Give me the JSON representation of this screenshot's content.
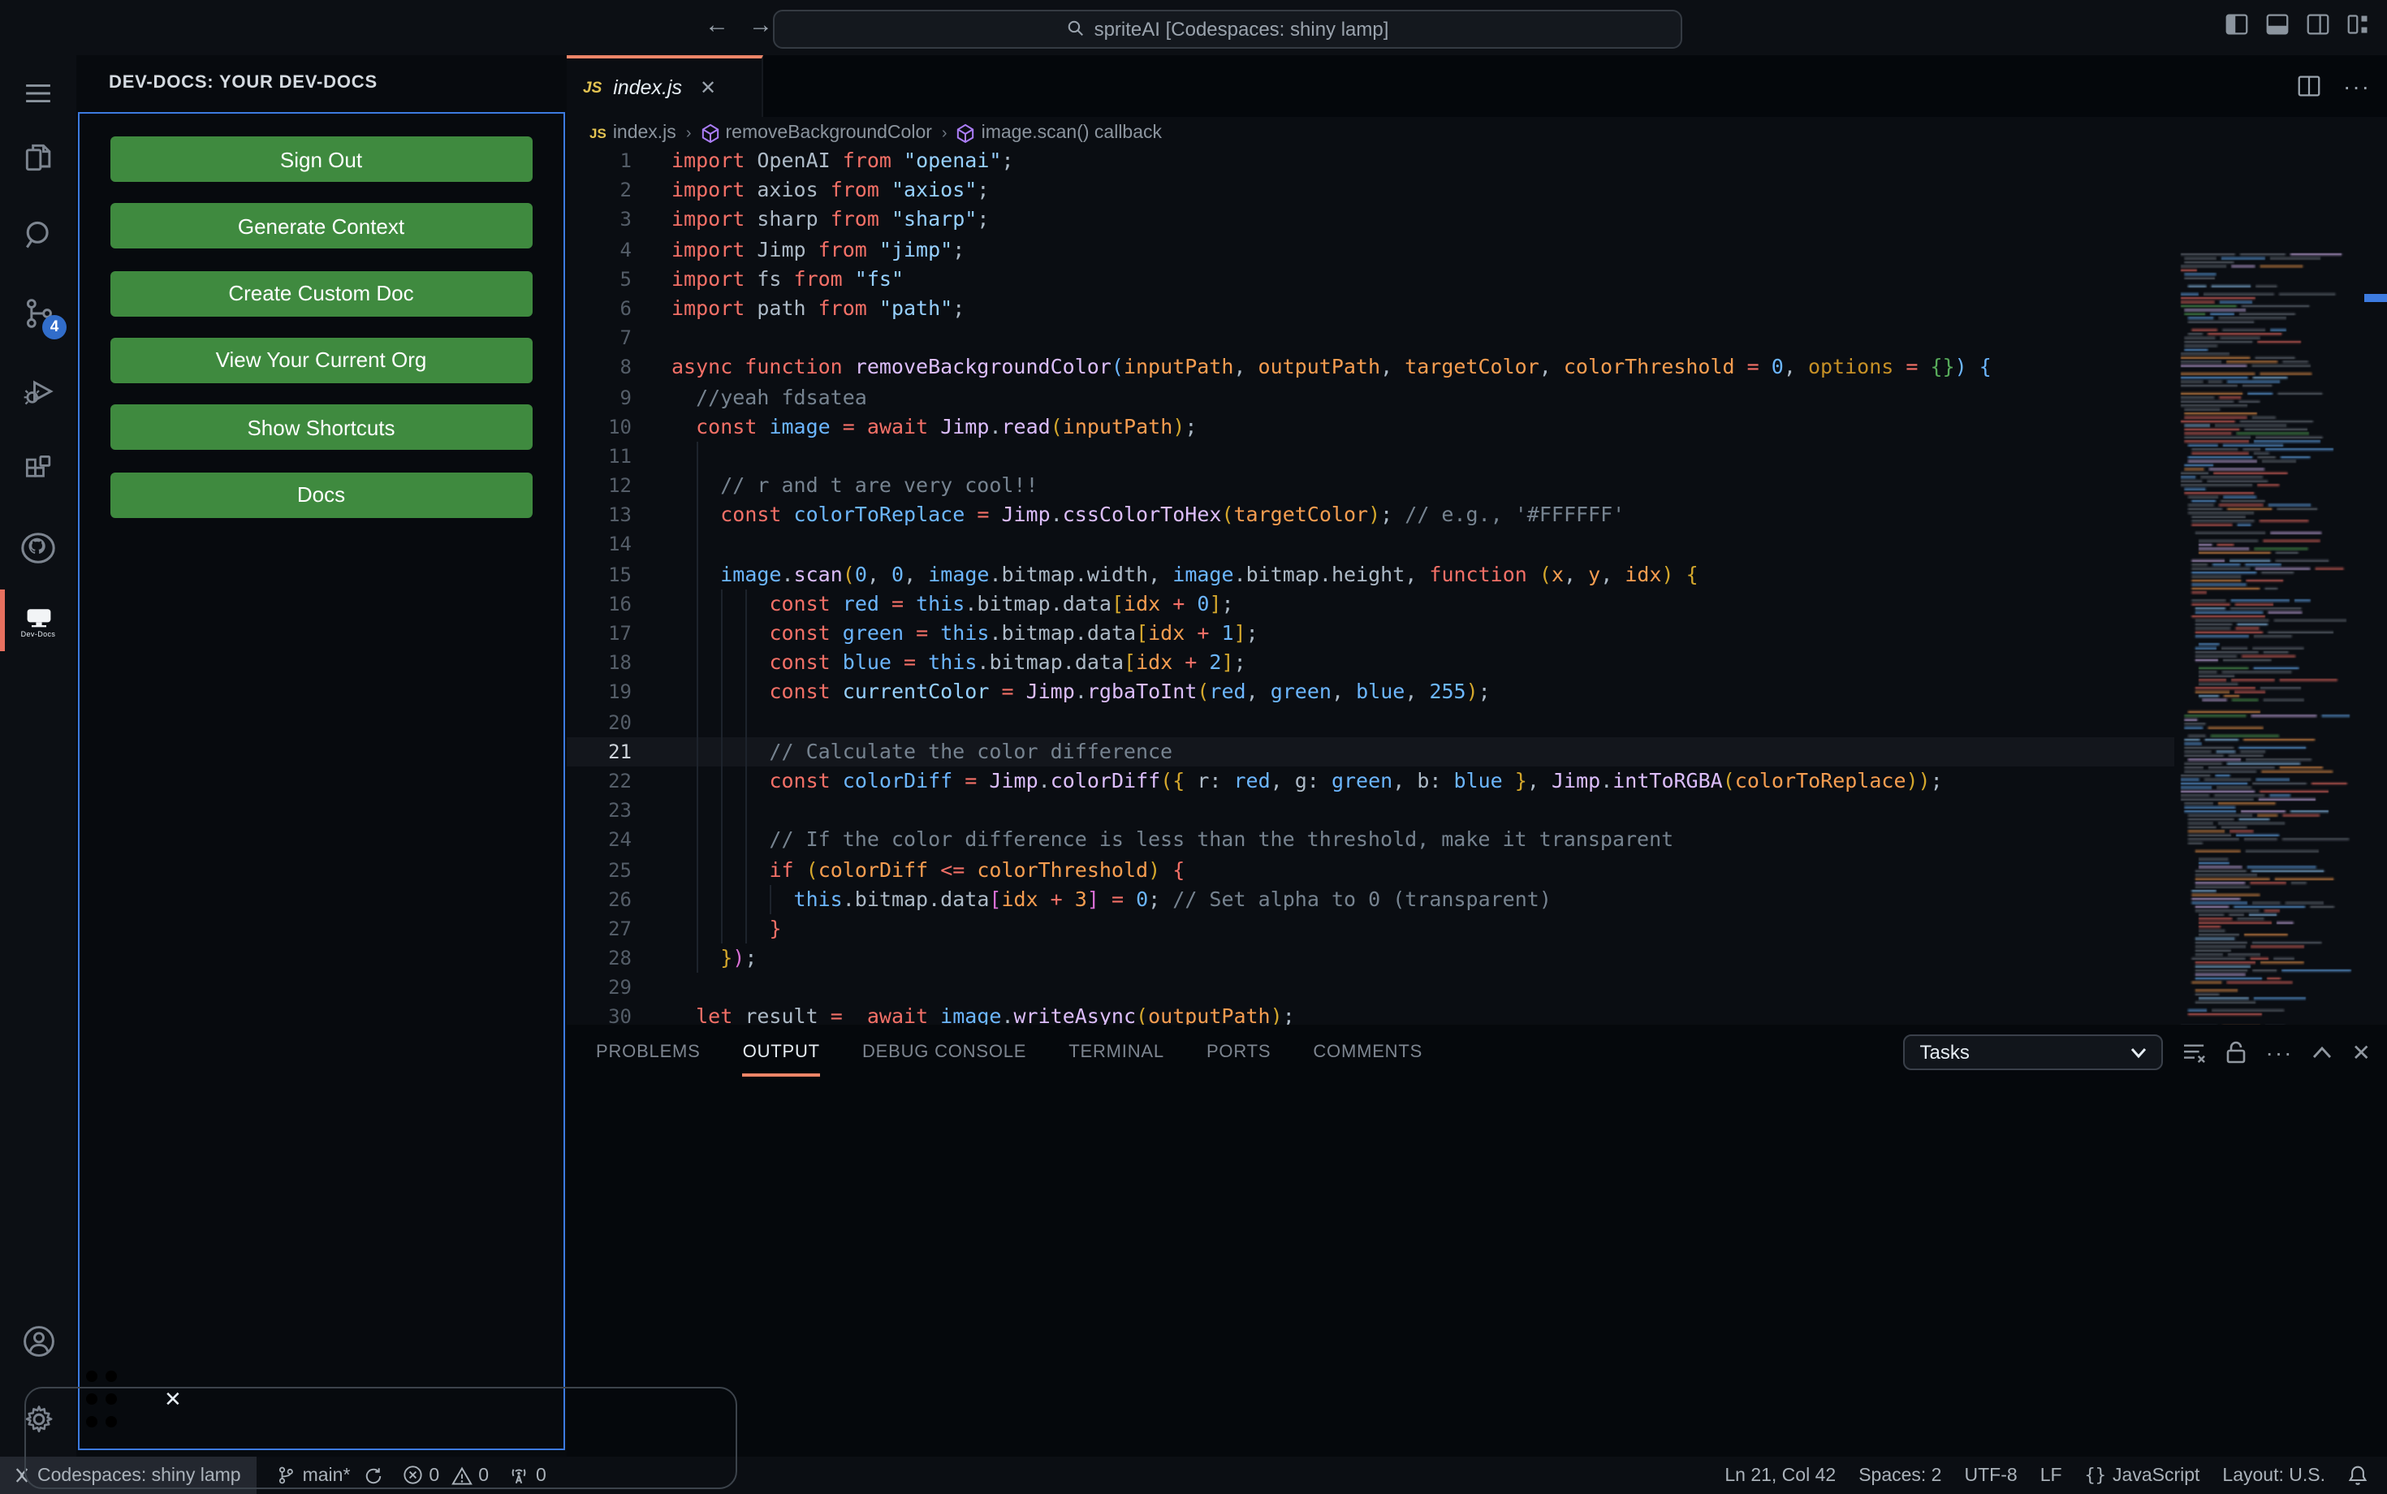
{
  "titlebar": {
    "search_value": "spriteAI [Codespaces: shiny lamp]",
    "back": "←",
    "forward": "→"
  },
  "activitybar": {
    "scm_badge": "4",
    "devdocs_label": "Dev-Docs"
  },
  "sidebar": {
    "header": "DEV-DOCS: YOUR DEV-DOCS",
    "buttons": [
      "Sign Out",
      "Generate Context",
      "Create Custom Doc",
      "View Your Current Org",
      "Show Shortcuts",
      "Docs"
    ],
    "webview_close": "✕"
  },
  "editor": {
    "tab": {
      "badge": "JS",
      "label": "index.js",
      "close": "✕"
    },
    "breadcrumbs": [
      {
        "icon": "js",
        "label": "index.js"
      },
      {
        "icon": "symbol",
        "label": "removeBackgroundColor"
      },
      {
        "icon": "symbol",
        "label": "image.scan() callback"
      }
    ],
    "active_line": 21,
    "code": {
      "lines": [
        [
          [
            "kw",
            "import"
          ],
          [
            "pl",
            " OpenAI "
          ],
          [
            "kw",
            "from"
          ],
          [
            "st",
            " \"openai\""
          ],
          [
            "pl",
            ";"
          ]
        ],
        [
          [
            "kw",
            "import"
          ],
          [
            "pl",
            " axios "
          ],
          [
            "kw",
            "from"
          ],
          [
            "st",
            " \"axios\""
          ],
          [
            "pl",
            ";"
          ]
        ],
        [
          [
            "kw",
            "import"
          ],
          [
            "pl",
            " sharp "
          ],
          [
            "kw",
            "from"
          ],
          [
            "st",
            " \"sharp\""
          ],
          [
            "pl",
            ";"
          ]
        ],
        [
          [
            "kw",
            "import"
          ],
          [
            "pl",
            " Jimp "
          ],
          [
            "kw",
            "from"
          ],
          [
            "st",
            " \"jimp\""
          ],
          [
            "pl",
            ";"
          ]
        ],
        [
          [
            "kw",
            "import"
          ],
          [
            "pl",
            " fs "
          ],
          [
            "kw",
            "from"
          ],
          [
            "st",
            " \"fs\""
          ]
        ],
        [
          [
            "kw",
            "import"
          ],
          [
            "pl",
            " path "
          ],
          [
            "kw",
            "from"
          ],
          [
            "st",
            " \"path\""
          ],
          [
            "pl",
            ";"
          ]
        ],
        [],
        [
          [
            "kw",
            "async function"
          ],
          [
            "fn",
            " removeBackgroundColor"
          ],
          [
            "b1",
            "("
          ],
          [
            "pa",
            "inputPath"
          ],
          [
            "pl",
            ","
          ],
          [
            "pa",
            " outputPath"
          ],
          [
            "pl",
            ","
          ],
          [
            "pa",
            " targetColor"
          ],
          [
            "pl",
            ","
          ],
          [
            "pa",
            " colorThreshold"
          ],
          [
            "op",
            " ="
          ],
          [
            "nu",
            " 0"
          ],
          [
            "pl",
            ","
          ],
          [
            "tn",
            " options"
          ],
          [
            "op",
            " ="
          ],
          [
            "b2",
            " {}"
          ],
          [
            "b1",
            ")"
          ],
          [
            "pl",
            " "
          ],
          [
            "b1",
            "{"
          ]
        ],
        [
          [
            "cm",
            "  //yeah fdsatea"
          ]
        ],
        [
          [
            "pl",
            "  "
          ],
          [
            "kw",
            "const"
          ],
          [
            "vr",
            " image"
          ],
          [
            "op",
            " ="
          ],
          [
            "kw",
            " await"
          ],
          [
            "fn",
            " Jimp"
          ],
          [
            "pl",
            "."
          ],
          [
            "fn",
            "read"
          ],
          [
            "b3",
            "("
          ],
          [
            "pa",
            "inputPath"
          ],
          [
            "b3",
            ")"
          ],
          [
            "pl",
            ";"
          ]
        ],
        [],
        [
          [
            "cm",
            "    // r and t are very cool!!"
          ]
        ],
        [
          [
            "pl",
            "    "
          ],
          [
            "kw",
            "const"
          ],
          [
            "vr",
            " colorToReplace"
          ],
          [
            "op",
            " ="
          ],
          [
            "fn",
            " Jimp"
          ],
          [
            "pl",
            "."
          ],
          [
            "fn",
            "cssColorToHex"
          ],
          [
            "b3",
            "("
          ],
          [
            "pa",
            "targetColor"
          ],
          [
            "b3",
            ")"
          ],
          [
            "pl",
            "; "
          ],
          [
            "cm",
            "// e.g., '#FFFFFF'"
          ]
        ],
        [],
        [
          [
            "pl",
            "    "
          ],
          [
            "vr",
            "image"
          ],
          [
            "pl",
            "."
          ],
          [
            "fn",
            "scan"
          ],
          [
            "b3",
            "("
          ],
          [
            "nu",
            "0"
          ],
          [
            "pl",
            ", "
          ],
          [
            "nu",
            "0"
          ],
          [
            "pl",
            ", "
          ],
          [
            "vr",
            "image"
          ],
          [
            "pl",
            ".bitmap.width, "
          ],
          [
            "vr",
            "image"
          ],
          [
            "pl",
            ".bitmap.height, "
          ],
          [
            "kw",
            "function "
          ],
          [
            "b3",
            "("
          ],
          [
            "pa",
            "x"
          ],
          [
            "pl",
            ", "
          ],
          [
            "pa",
            "y"
          ],
          [
            "pl",
            ", "
          ],
          [
            "pa",
            "idx"
          ],
          [
            "b3",
            ")"
          ],
          [
            "pl",
            " "
          ],
          [
            "b3",
            "{"
          ]
        ],
        [
          [
            "pl",
            "        "
          ],
          [
            "kw",
            "const"
          ],
          [
            "vr",
            " red"
          ],
          [
            "op",
            " ="
          ],
          [
            "vr",
            " this"
          ],
          [
            "pl",
            ".bitmap.data"
          ],
          [
            "b3",
            "["
          ],
          [
            "pa",
            "idx"
          ],
          [
            "op",
            " +"
          ],
          [
            "nu",
            " 0"
          ],
          [
            "b3",
            "]"
          ],
          [
            "pl",
            ";"
          ]
        ],
        [
          [
            "pl",
            "        "
          ],
          [
            "kw",
            "const"
          ],
          [
            "vr",
            " green"
          ],
          [
            "op",
            " ="
          ],
          [
            "vr",
            " this"
          ],
          [
            "pl",
            ".bitmap.data"
          ],
          [
            "b3",
            "["
          ],
          [
            "pa",
            "idx"
          ],
          [
            "op",
            " +"
          ],
          [
            "nu",
            " 1"
          ],
          [
            "b3",
            "]"
          ],
          [
            "pl",
            ";"
          ]
        ],
        [
          [
            "pl",
            "        "
          ],
          [
            "kw",
            "const"
          ],
          [
            "vr",
            " blue"
          ],
          [
            "op",
            " ="
          ],
          [
            "vr",
            " this"
          ],
          [
            "pl",
            ".bitmap.data"
          ],
          [
            "b3",
            "["
          ],
          [
            "pa",
            "idx"
          ],
          [
            "op",
            " +"
          ],
          [
            "nu",
            " 2"
          ],
          [
            "b3",
            "]"
          ],
          [
            "pl",
            ";"
          ]
        ],
        [
          [
            "pl",
            "        "
          ],
          [
            "kw",
            "const"
          ],
          [
            "cs",
            " currentColor"
          ],
          [
            "op",
            " ="
          ],
          [
            "fn",
            " Jimp"
          ],
          [
            "pl",
            "."
          ],
          [
            "fn",
            "rgbaToInt"
          ],
          [
            "b3",
            "("
          ],
          [
            "vr",
            "red"
          ],
          [
            "pl",
            ", "
          ],
          [
            "vr",
            "green"
          ],
          [
            "pl",
            ", "
          ],
          [
            "vr",
            "blue"
          ],
          [
            "pl",
            ", "
          ],
          [
            "nu",
            "255"
          ],
          [
            "b3",
            ")"
          ],
          [
            "pl",
            ";"
          ]
        ],
        [],
        [
          [
            "cm",
            "        // Calculate the color difference"
          ]
        ],
        [
          [
            "pl",
            "        "
          ],
          [
            "kw",
            "const"
          ],
          [
            "vr",
            " colorDiff"
          ],
          [
            "op",
            " ="
          ],
          [
            "fn",
            " Jimp"
          ],
          [
            "pl",
            "."
          ],
          [
            "fn",
            "colorDiff"
          ],
          [
            "b3",
            "({ "
          ],
          [
            "pl",
            "r: "
          ],
          [
            "vr",
            "red"
          ],
          [
            "pl",
            ", g: "
          ],
          [
            "vr",
            "green"
          ],
          [
            "pl",
            ", b: "
          ],
          [
            "vr",
            "blue"
          ],
          [
            "b3",
            " }"
          ],
          [
            "pl",
            ", "
          ],
          [
            "fn",
            "Jimp"
          ],
          [
            "pl",
            "."
          ],
          [
            "fn",
            "intToRGBA"
          ],
          [
            "b3",
            "("
          ],
          [
            "pa",
            "colorToReplace"
          ],
          [
            "b3",
            "))"
          ],
          [
            "pl",
            ";"
          ]
        ],
        [],
        [
          [
            "cm",
            "        // If the color difference is less than the threshold, make it transparent"
          ]
        ],
        [
          [
            "pl",
            "        "
          ],
          [
            "kw",
            "if"
          ],
          [
            "pl",
            " "
          ],
          [
            "b3",
            "("
          ],
          [
            "pa",
            "colorDiff"
          ],
          [
            "op",
            " <="
          ],
          [
            "pa",
            " colorThreshold"
          ],
          [
            "b3",
            ")"
          ],
          [
            "pl",
            " "
          ],
          [
            "b5",
            "{"
          ]
        ],
        [
          [
            "pl",
            "          "
          ],
          [
            "vr",
            "this"
          ],
          [
            "pl",
            ".bitmap.data"
          ],
          [
            "b4",
            "["
          ],
          [
            "pa",
            "idx"
          ],
          [
            "op",
            " +"
          ],
          [
            "pa",
            " 3"
          ],
          [
            "b4",
            "]"
          ],
          [
            "op",
            " ="
          ],
          [
            "nu",
            " 0"
          ],
          [
            "pl",
            "; "
          ],
          [
            "cm",
            "// Set alpha to 0 (transparent)"
          ]
        ],
        [
          [
            "pl",
            "        "
          ],
          [
            "b5",
            "}"
          ]
        ],
        [
          [
            "pl",
            "    "
          ],
          [
            "b3",
            "}"
          ],
          [
            "b4",
            ")"
          ],
          [
            "pl",
            ";"
          ]
        ],
        [],
        [
          [
            "pl",
            "  "
          ],
          [
            "kw",
            "let"
          ],
          [
            "pl",
            " result"
          ],
          [
            "op",
            " = "
          ],
          [
            "kw",
            " await"
          ],
          [
            "vr",
            " image"
          ],
          [
            "pl",
            "."
          ],
          [
            "fn",
            "writeAsync"
          ],
          [
            "b3",
            "("
          ],
          [
            "pa",
            "outputPath"
          ],
          [
            "b3",
            ")"
          ],
          [
            "pl",
            ";"
          ]
        ]
      ]
    }
  },
  "panel": {
    "tabs": [
      "PROBLEMS",
      "OUTPUT",
      "DEBUG CONSOLE",
      "TERMINAL",
      "PORTS",
      "COMMENTS"
    ],
    "active_tab": "OUTPUT",
    "tasks_label": "Tasks"
  },
  "statusbar": {
    "remote": "Codespaces: shiny lamp",
    "branch": "main*",
    "errors": "0",
    "warnings": "0",
    "ports": "0",
    "line_col": "Ln 21, Col 42",
    "spaces": "Spaces: 2",
    "encoding": "UTF-8",
    "eol": "LF",
    "braces": "{ }",
    "language": "JavaScript",
    "layout": "Layout: U.S."
  },
  "colors": {
    "kw": "#f47067",
    "pl": "#adbac7",
    "st": "#96d0ff",
    "fn": "#dcbdfb",
    "vr": "#6cb6ff",
    "pa": "#f69d50",
    "nu": "#6cb6ff",
    "cm": "#768390",
    "op": "#f47067",
    "b1": "#6cb6ff",
    "b2": "#57ab5a",
    "b3": "#d4a72c",
    "b4": "#da70d6",
    "b5": "#f47067",
    "cs": "#96d0ff",
    "tn": "#c69026",
    "accent": "#ee8568",
    "button_green": "#3f8a3f",
    "focus_border": "#3d7be0",
    "badge_blue": "#316dca"
  }
}
